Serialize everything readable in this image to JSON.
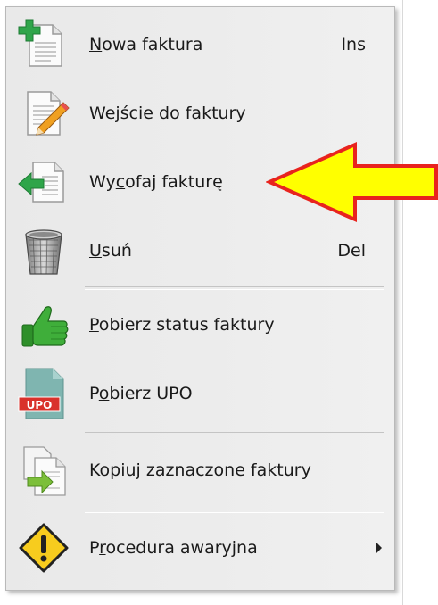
{
  "menu": {
    "items": [
      {
        "pre": "",
        "accel": "N",
        "post": "owa faktura",
        "shortcut": "Ins",
        "icon": "new-document-plus-icon"
      },
      {
        "pre": "",
        "accel": "W",
        "post": "ejście do faktury",
        "shortcut": "",
        "icon": "edit-document-pencil-icon"
      },
      {
        "pre": "Wy",
        "accel": "c",
        "post": "ofaj fakturę",
        "shortcut": "",
        "icon": "withdraw-document-arrow-icon"
      },
      {
        "pre": "",
        "accel": "U",
        "post": "suń",
        "shortcut": "Del",
        "icon": "trash-bin-icon"
      },
      {
        "pre": "",
        "accel": "P",
        "post": "obierz status faktury",
        "shortcut": "",
        "icon": "thumbs-up-icon"
      },
      {
        "pre": "P",
        "accel": "o",
        "post": "bierz UPO",
        "shortcut": "",
        "icon": "upo-document-icon"
      },
      {
        "pre": "",
        "accel": "K",
        "post": "opiuj zaznaczone faktury",
        "shortcut": "",
        "icon": "copy-documents-arrow-icon"
      },
      {
        "pre": "P",
        "accel": "r",
        "post": "ocedura awaryjna",
        "shortcut": "",
        "icon": "warning-diamond-icon"
      }
    ],
    "upo_badge": "UPO"
  },
  "colors": {
    "menu_background": "#ececec",
    "pointer_fill": "#ffff00",
    "pointer_stroke": "#e8231e",
    "plus_green": "#2fa54a",
    "thumb_green": "#3fae3a",
    "upo_red": "#d9312b"
  }
}
